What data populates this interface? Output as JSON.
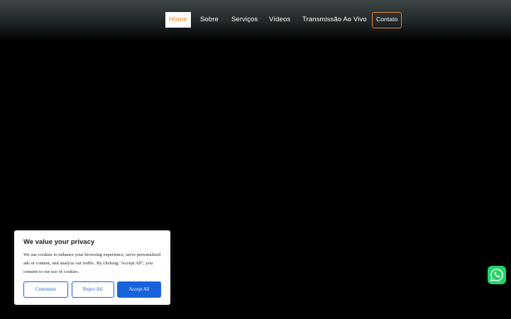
{
  "nav": {
    "items": [
      {
        "label": "Home"
      },
      {
        "label": "Sobre"
      },
      {
        "label": "Serviços"
      },
      {
        "label": "Vídeos"
      },
      {
        "label": "Transmissão Ao Vivo"
      }
    ],
    "cta_label": "Contato"
  },
  "cookie": {
    "title": "We value your privacy",
    "text": "We use cookies to enhance your browsing experience, serve personalized ads or content, and analyze our traffic. By clicking \"Accept All\", you consent to our use of cookies.",
    "customize_label": "Customize",
    "reject_label": "Reject All",
    "accept_label": "Accept All"
  },
  "colors": {
    "accent": "#e8842e",
    "cookie_button": "#1863dc",
    "whatsapp": "#25d366"
  },
  "icons": {
    "whatsapp": "whatsapp-icon"
  }
}
